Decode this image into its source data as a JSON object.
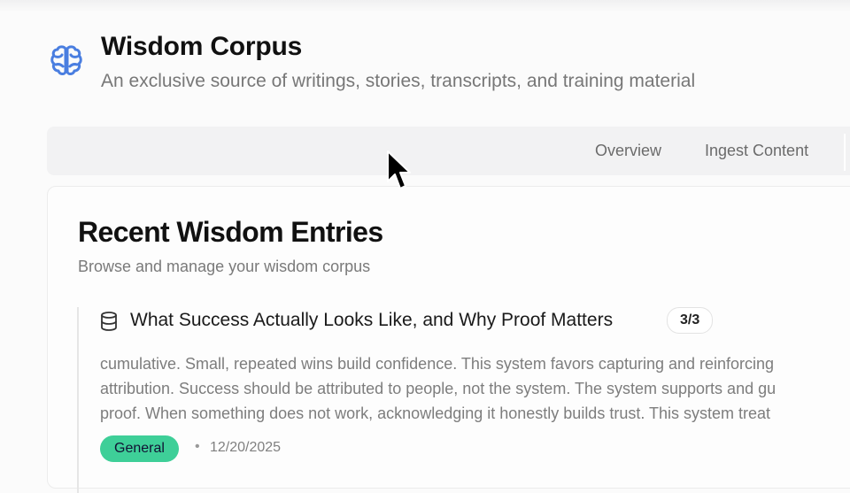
{
  "app": {
    "title": "Wisdom Corpus",
    "subtitle": "An exclusive source of writings, stories, transcripts, and training material",
    "logo_icon": "brain-icon",
    "accent_color": "#4a7ee0"
  },
  "nav": {
    "tabs": [
      {
        "label": "Overview"
      },
      {
        "label": "Ingest Content"
      }
    ]
  },
  "panel": {
    "title": "Recent Wisdom Entries",
    "description": "Browse and manage your wisdom corpus"
  },
  "entries": [
    {
      "icon": "database-icon",
      "title": "What Success Actually Looks Like, and Why Proof Matters",
      "count": "3/3",
      "lines": [
        "cumulative. Small, repeated wins build confidence. This system favors capturing and reinforcing",
        "attribution. Success should be attributed to people, not the system. The system supports and gu",
        "proof. When something does not work, acknowledging it honestly builds trust. This system treat"
      ],
      "tag": "General",
      "tag_color": "#3ecf98",
      "separator": "•",
      "date": "12/20/2025"
    }
  ]
}
